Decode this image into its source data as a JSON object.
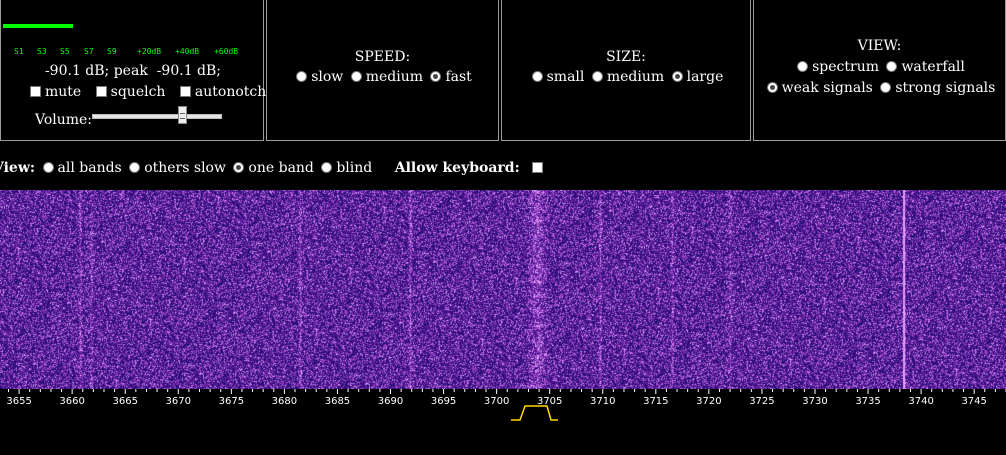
{
  "meter": {
    "s_labels": [
      "S1",
      "S3",
      "S5",
      "S7",
      "S9",
      "+20dB",
      "+40dB",
      "+60dB"
    ],
    "level_text": "-90.1 dB; peak  -90.1 dB;",
    "mute_label": "mute",
    "squelch_label": "squelch",
    "autonotch_label": "autonotch",
    "volume_label": "Volume:",
    "volume_level": 0.72,
    "bar_color": "#00ff00"
  },
  "speed": {
    "title": "SPEED:",
    "options": [
      "slow",
      "medium",
      "fast"
    ],
    "selected": "fast"
  },
  "size": {
    "title": "SIZE:",
    "options": [
      "small",
      "medium",
      "large"
    ],
    "selected": "large"
  },
  "view_panel": {
    "title": "VIEW:",
    "opt_spectrum": "spectrum",
    "opt_waterfall": "waterfall",
    "opt_weak": "weak signals",
    "opt_strong": "strong signals",
    "selected_display": "none",
    "selected_mode": "weak signals"
  },
  "viewbar": {
    "view_label": "View:",
    "options": [
      "all bands",
      "others slow",
      "one band",
      "blind"
    ],
    "selected": "one band",
    "keyboard_label": "Allow keyboard:"
  },
  "waterfall": {
    "background_color": "#2a1590",
    "signal_color": "#e0a0ff",
    "strong_signal_freq": 3703.8
  },
  "scale": {
    "start_khz": 3653.2,
    "end_khz": 3748.0,
    "labels": [
      "3655",
      "3660",
      "3665",
      "3670",
      "3675",
      "3680",
      "3685",
      "3690",
      "3695",
      "3700",
      "3705",
      "3710",
      "3715",
      "3720",
      "3725",
      "3730",
      "3735",
      "3740",
      "3745"
    ],
    "tuned_khz": 3703.0,
    "passband_color": "#ffd700"
  }
}
